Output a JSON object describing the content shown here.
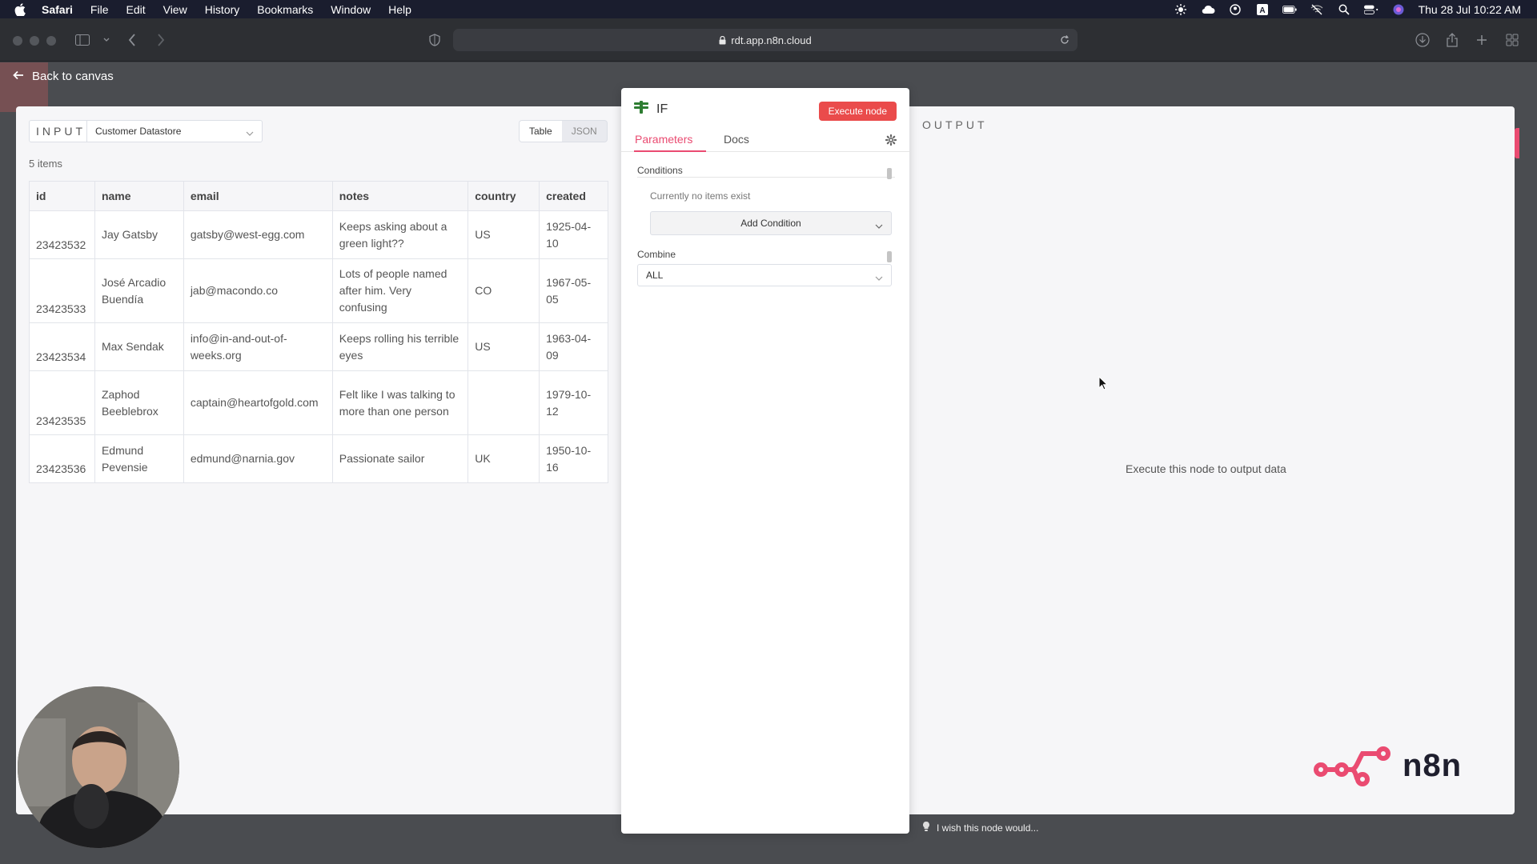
{
  "menubar": {
    "app": "Safari",
    "items": [
      "File",
      "Edit",
      "View",
      "History",
      "Bookmarks",
      "Window",
      "Help"
    ],
    "clock": "Thu 28 Jul  10:22 AM"
  },
  "browser": {
    "url": "rdt.app.n8n.cloud"
  },
  "nav": {
    "back_label": "Back to canvas"
  },
  "input_panel": {
    "label": "INPUT",
    "source": "Customer Datastore",
    "view_toggle": [
      "Table",
      "JSON"
    ],
    "count": "5 items",
    "columns": [
      "id",
      "name",
      "email",
      "notes",
      "country",
      "created"
    ],
    "rows": [
      [
        "23423532",
        "Jay Gatsby",
        "gatsby@west-egg.com",
        "Keeps asking about a green light??",
        "US",
        "1925-04-10"
      ],
      [
        "23423533",
        "José Arcadio Buendía",
        "jab@macondo.co",
        "Lots of people named after him. Very confusing",
        "CO",
        "1967-05-05"
      ],
      [
        "23423534",
        "Max Sendak",
        "info@in-and-out-of-weeks.org",
        "Keeps rolling his terrible eyes",
        "US",
        "1963-04-09"
      ],
      [
        "23423535",
        "Zaphod Beeblebrox",
        "captain@heartofgold.com",
        "Felt like I was talking to more than one person",
        "",
        "1979-10-12"
      ],
      [
        "23423536",
        "Edmund Pevensie",
        "edmund@narnia.gov",
        "Passionate sailor",
        "UK",
        "1950-10-16"
      ]
    ]
  },
  "node": {
    "title": "IF",
    "execute_label": "Execute node",
    "tabs": [
      "Parameters",
      "Docs"
    ],
    "conditions_label": "Conditions",
    "no_items_text": "Currently no items exist",
    "add_condition_label": "Add Condition",
    "combine_label": "Combine",
    "combine_value": "ALL"
  },
  "output_panel": {
    "label": "OUTPUT",
    "empty_message": "Execute this node to output data"
  },
  "feedback": {
    "text": "I wish this node would..."
  },
  "branding": {
    "logo_text": "n8n"
  },
  "colors": {
    "accent": "#ea4b71",
    "execute": "#ea4b4b",
    "node_icon": "#2e7d32"
  }
}
